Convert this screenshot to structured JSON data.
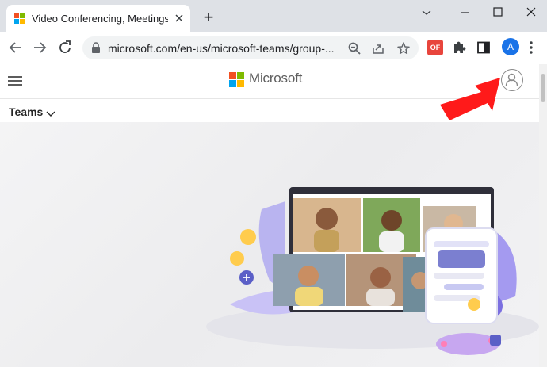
{
  "browser": {
    "tab_title": "Video Conferencing, Meetings, C",
    "new_tab_symbol": "+",
    "url": "microsoft.com/en-us/microsoft-teams/group-...",
    "extension_label": "OF",
    "profile_initial": "A",
    "window_controls": [
      "minimize",
      "maximize",
      "close"
    ]
  },
  "site": {
    "brand": "Microsoft",
    "nav_label": "Teams",
    "logo_colors": [
      "#f25022",
      "#7fba00",
      "#00a4ef",
      "#ffb900"
    ]
  },
  "icons": {
    "favicon": "microsoft-logo-icon",
    "back": "arrow-left-icon",
    "forward": "arrow-right-icon",
    "reload": "reload-icon",
    "lock": "lock-icon",
    "zoom": "zoom-icon",
    "share": "share-icon",
    "bookmark": "star-icon",
    "extensions": "puzzle-icon",
    "sidepanel": "side-panel-icon",
    "menu": "kebab-menu-icon",
    "hamburger": "hamburger-icon",
    "account": "account-icon",
    "annotation": "red-arrow-icon"
  },
  "colors": {
    "accent": "#1a73e8",
    "annotation": "#ff1a1a",
    "teams_purple": "#6264a7"
  }
}
